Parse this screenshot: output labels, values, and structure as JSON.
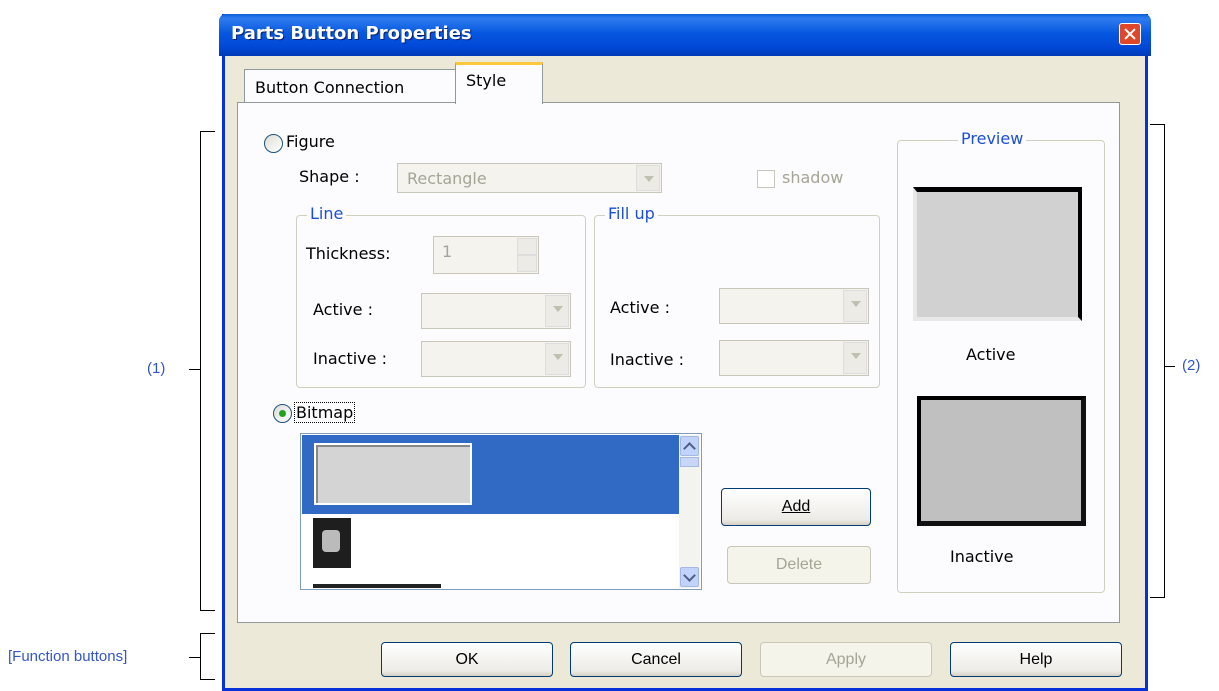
{
  "annotations": {
    "left_label": "(1)",
    "right_label": "(2)",
    "function_label": "[Function buttons]"
  },
  "dialog": {
    "title": "Parts Button Properties",
    "tabs": [
      {
        "label": "Button Connection",
        "selected": false
      },
      {
        "label": "Style",
        "selected": true
      }
    ]
  },
  "figure": {
    "radio_label": "Figure",
    "selected": false,
    "shape_label": "Shape :",
    "shape_value": "Rectangle",
    "shadow_label": "shadow",
    "shadow_checked": false
  },
  "line": {
    "title": "Line",
    "thickness_label": "Thickness:",
    "thickness_value": "1",
    "active_label": "Active :",
    "inactive_label": "Inactive :"
  },
  "fill": {
    "title": "Fill up",
    "active_label": "Active :",
    "inactive_label": "Inactive :"
  },
  "bitmap": {
    "radio_label": "Bitmap",
    "selected": true,
    "add_label": "Add",
    "delete_label": "Delete"
  },
  "preview": {
    "title": "Preview",
    "active_label": "Active",
    "inactive_label": "Inactive"
  },
  "footer": {
    "ok": "OK",
    "cancel": "Cancel",
    "apply": "Apply",
    "help": "Help"
  },
  "colors": {
    "titlebar": "#0054e3",
    "group_title": "#1c4ed8",
    "selection": "#316ac5",
    "annotation": "#3355cc"
  }
}
